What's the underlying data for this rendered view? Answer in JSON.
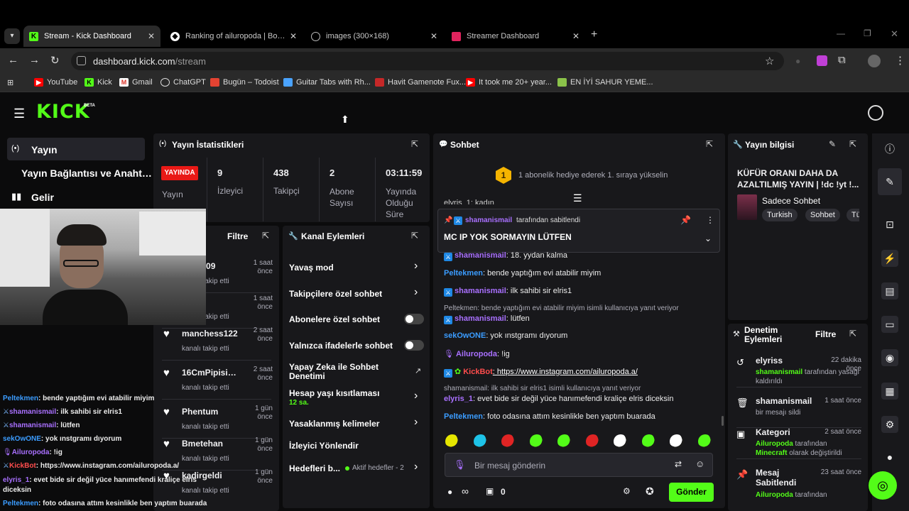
{
  "browser": {
    "tabs": [
      {
        "title": "Stream - Kick Dashboard",
        "active": true
      },
      {
        "title": "Ranking of ailuropoda | BotRix -",
        "active": false
      },
      {
        "title": "images (300×168)",
        "active": false
      },
      {
        "title": "Streamer Dashboard",
        "active": false
      }
    ],
    "url_host": "dashboard.kick.com",
    "url_path": "/stream",
    "bookmarks": [
      "YouTube",
      "Kick",
      "Gmail",
      "ChatGPT",
      "Bugün – Todoist",
      "Guitar Tabs with Rh...",
      "Havit Gamenote Fux...",
      "It took me 20+ year...",
      "EN İYİ SAHUR YEME..."
    ]
  },
  "header": {
    "logo": "KICK",
    "beta": "BETA"
  },
  "sidebar": {
    "items": [
      {
        "label": "Yayın",
        "icon": "broadcast-icon"
      },
      {
        "label": "Yayın Bağlantısı ve Anahtarı"
      },
      {
        "label": "Gelir",
        "icon": "chart-icon"
      }
    ]
  },
  "stats": {
    "title": "Yayın İstatistikleri",
    "live_badge": "YAYINDA",
    "items": [
      {
        "value": "",
        "label": "Yayın"
      },
      {
        "value": "9",
        "label": "İzleyici"
      },
      {
        "value": "438",
        "label": "Takipçi"
      },
      {
        "value": "2",
        "label": "Abone Sayısı"
      },
      {
        "value": "03:11:59",
        "label": "Yayında Olduğu Süre"
      }
    ]
  },
  "activity": {
    "filter": "Filtre",
    "items": [
      {
        "name": "kemal09",
        "desc": "kanalı takip etti",
        "time": "1 saat önce"
      },
      {
        "name": "",
        "desc": "kanalı takip etti",
        "time": "1 saat önce"
      },
      {
        "name": "manchess122",
        "desc": "kanalı takip etti",
        "time": "2 saat önce"
      },
      {
        "name": "16CmPipisimVar",
        "desc": "kanalı takip etti",
        "time": "2 saat önce"
      },
      {
        "name": "Phentum",
        "desc": "kanalı takip etti",
        "time": "1 gün önce"
      },
      {
        "name": "Bmetehan",
        "desc": "kanalı takip etti",
        "time": "1 gün önce"
      },
      {
        "name": "kadirgeldi",
        "desc": "kanalı takip etti",
        "time": "1 gün önce"
      }
    ]
  },
  "channel_actions": {
    "title": "Kanal Eylemleri",
    "slow_mode": "Yavaş mod",
    "followers_only": "Takipçilere özel sohbet",
    "subs_only": "Abonelere özel sohbet",
    "emotes_only": "Yalnızca ifadelerle sohbet",
    "ai_moderation": "Yapay Zeka ile Sohbet Denetimi",
    "account_age": "Hesap yaşı kısıtlaması",
    "account_age_value": "12 sa.",
    "banned_words": "Yasaklanmış kelimeler",
    "redirect": "İzleyici Yönlendir",
    "goals": "Hedefleri b...",
    "goals_status": "Aktif hedefler - 2"
  },
  "chat": {
    "title": "Sohbet",
    "gift_banner": "1 abonelik hediye ederek 1. sıraya yükselin",
    "gift_rank": "1",
    "pinned_by_user": "shamanismail",
    "pinned_by_suffix": "tarafından sabitlendi",
    "pinned_message": "MC IP YOK SORMAYIN LÜTFEN",
    "partial_top": "elyris_1: kadın",
    "messages": [
      {
        "user": "shamanismail",
        "text": ": 18. yydan kalma",
        "color": "#a970ff"
      },
      {
        "user": "Peltekmen",
        "text": ": bende yaptığım evi atabilir miyim",
        "color": "#3b9cff"
      },
      {
        "user": "shamanismail",
        "text": ": ilk sahibi sir elris1",
        "color": "#a970ff"
      },
      {
        "user": "shamanismail",
        "text": ": lütfen",
        "color": "#a970ff"
      },
      {
        "user": "sekOwONE",
        "text": ": yok ınstgramı dıyorum",
        "color": "#3b9cff"
      },
      {
        "user": "Ailuropoda",
        "text": ": !ig",
        "color": "#a970ff"
      },
      {
        "user": "KickBot",
        "text": ": https://www.instagram.com/ailuropoda.a/",
        "color": "#ff4d4d"
      },
      {
        "user": "elyris_1",
        "text": ": evet bide sir değil yüce hanımefendi kraliçe elris diceksin",
        "color": "#a970ff"
      },
      {
        "user": "Peltekmen",
        "text": ": foto odasına attım kesinlikle ben yaptım buarada",
        "color": "#3b9cff"
      }
    ],
    "reply1": "Peltekmen: bende yaptığım evi atabilir miyim isimli kullanıcıya yanıt veriyor",
    "reply2": "shamanismail: ilk sahibi sir elris1 isimli kullanıcıya yanıt veriyor",
    "input_placeholder": "Bir mesaj gönderin",
    "points": "∞",
    "gift_count": "0",
    "send": "Gönder"
  },
  "stream_info": {
    "title": "Yayın bilgisi",
    "stream_title": "KÜFÜR ORANI DAHA DA AZALTILMIŞ YAYIN | !dc !yt !...",
    "category": "Sadece Sohbet",
    "tags": [
      "Turkish",
      "Sohbet",
      "Tü"
    ]
  },
  "mod_actions": {
    "title": "Denetim Eylemleri",
    "filter": "Filtre",
    "items": [
      {
        "name": "elyriss",
        "time": "22 dakika önce",
        "actor": "shamanismail",
        "desc": " tarafından yasağı kaldırıldı"
      },
      {
        "name": "shamanismail",
        "time": "1 saat önce",
        "actor": "",
        "desc": "bir mesajı sildi"
      },
      {
        "name": "Kategori",
        "time": "2 saat önce",
        "actor": "Ailuropoda",
        "desc": " tarafından ",
        "extra": "Minecraft",
        "extra_desc": " olarak değiştirildi"
      },
      {
        "name": "Mesaj Sabitlendi",
        "time": "23 saat önce",
        "actor": "Ailuropoda",
        "desc": " tarafından"
      }
    ]
  },
  "webcam_chat": [
    {
      "user": "Peltekmen",
      "text": ": bende yaptığım evi atabilir miyim",
      "color": "#3b9cff"
    },
    {
      "user": "shamanismail",
      "text": ": ilk sahibi sir elris1",
      "color": "#a970ff"
    },
    {
      "user": "shamanismail",
      "text": ": lütfen",
      "color": "#a970ff"
    },
    {
      "user": "sekOwONE",
      "text": ": yok ınstgramı dıyorum",
      "color": "#3b9cff"
    },
    {
      "user": "Ailuropoda",
      "text": ": !ig",
      "color": "#a970ff"
    },
    {
      "user": "KickBot",
      "text": ": https://www.instagram.com/ailuropoda.a/",
      "color": "#ff4d4d"
    },
    {
      "user": "elyris_1",
      "text": ": evet bide sir değil yüce hanımefendi kraliçe elris diceksin",
      "color": "#a970ff"
    },
    {
      "user": "Peltekmen",
      "text": ": foto odasına attım kesinlikle ben yaptım buarada",
      "color": "#3b9cff"
    }
  ],
  "colors": {
    "kick_green": "#53fc18",
    "panel": "#18181b",
    "live_red": "#e91916"
  }
}
